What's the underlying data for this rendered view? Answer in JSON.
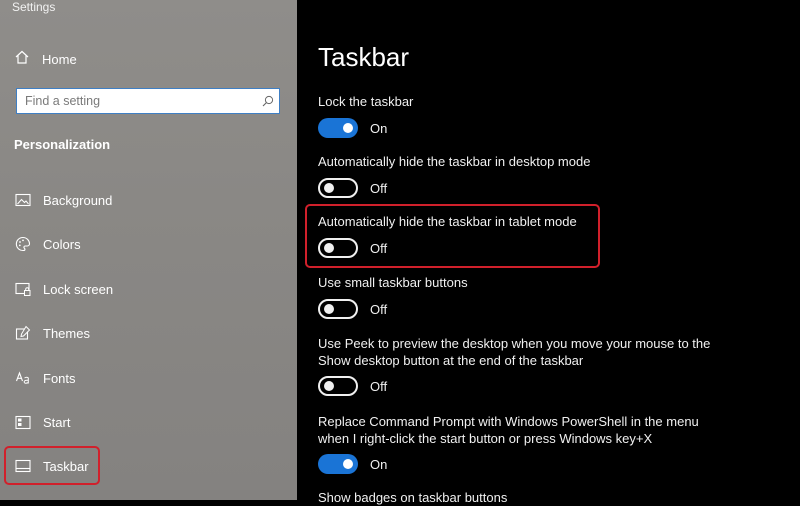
{
  "window": {
    "title": "Settings"
  },
  "sidebar": {
    "home_label": "Home",
    "search": {
      "placeholder": "Find a setting"
    },
    "section_title": "Personalization",
    "items": [
      {
        "label": "Background",
        "icon": "image-icon"
      },
      {
        "label": "Colors",
        "icon": "palette-icon"
      },
      {
        "label": "Lock screen",
        "icon": "lock-screen-icon"
      },
      {
        "label": "Themes",
        "icon": "themes-icon"
      },
      {
        "label": "Fonts",
        "icon": "fonts-icon"
      },
      {
        "label": "Start",
        "icon": "start-icon"
      },
      {
        "label": "Taskbar",
        "icon": "taskbar-icon",
        "selected": true
      }
    ]
  },
  "main": {
    "title": "Taskbar",
    "settings": [
      {
        "label": "Lock the taskbar",
        "state": "On"
      },
      {
        "label": "Automatically hide the taskbar in desktop mode",
        "state": "Off"
      },
      {
        "label": "Automatically hide the taskbar in tablet mode",
        "state": "Off"
      },
      {
        "label": "Use small taskbar buttons",
        "state": "Off"
      },
      {
        "label_line1": "Use Peek to preview the desktop when you move your mouse to the",
        "label_line2": "Show desktop button at the end of the taskbar",
        "state": "Off"
      },
      {
        "label_line1": "Replace Command Prompt with Windows PowerShell in the menu",
        "label_line2": "when I right-click the start button or press Windows key+X",
        "state": "On"
      },
      {
        "label": "Show badges on taskbar buttons"
      }
    ]
  },
  "colors": {
    "toggle_on": "#1a74d6",
    "highlight": "#d1202b",
    "sidebar_bg": "#8a8885",
    "main_bg": "#000000"
  }
}
